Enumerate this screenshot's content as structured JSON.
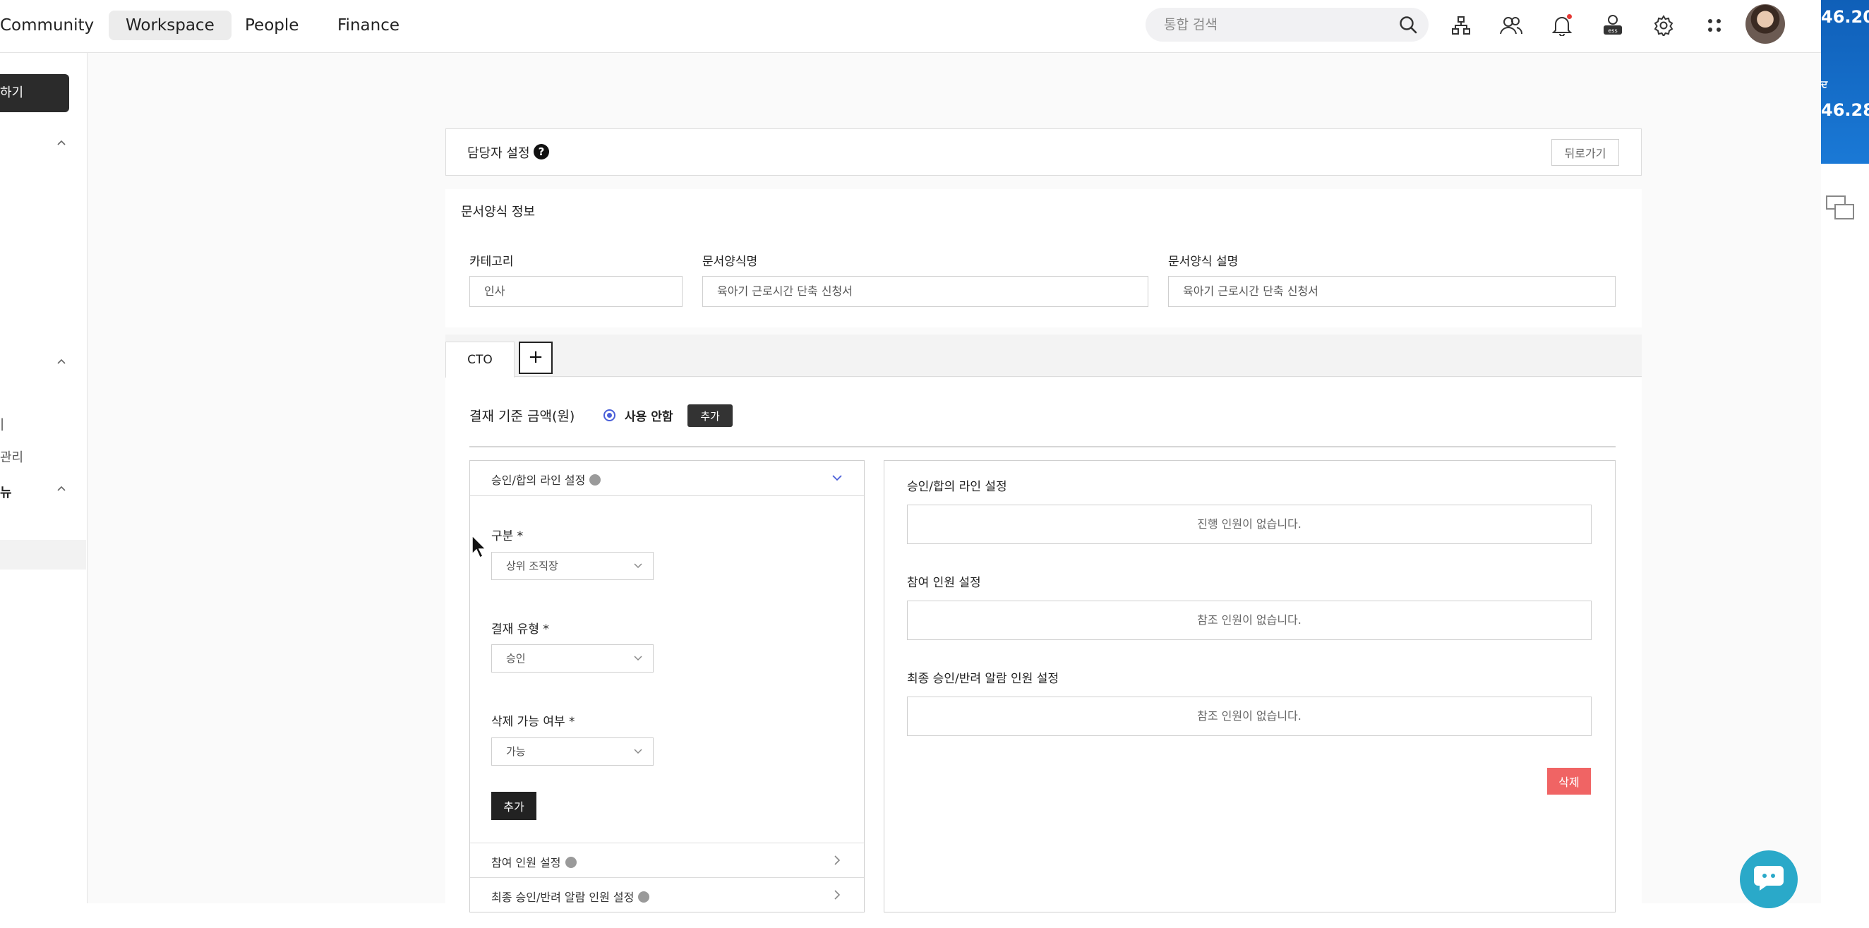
{
  "nav": {
    "items": [
      "Community",
      "Workspace",
      "People",
      "Finance"
    ],
    "active": "Workspace",
    "search_placeholder": "통합 검색"
  },
  "icons": {
    "org": "org-chart-icon",
    "people": "people-icon",
    "bell": "bell-icon",
    "ess": "ess-icon",
    "settings": "gear-icon",
    "apps": "apps-grid-icon"
  },
  "right_strip": {
    "clock1": "46.20",
    "clock2": "46.28"
  },
  "sidebar": {
    "button": "하기",
    "items": [
      "|",
      "관리",
      "뉴"
    ]
  },
  "header": {
    "title": "담당자 설정",
    "help": "?",
    "back": "뒤로가기"
  },
  "form_info": {
    "title": "문서양식 정보",
    "fields": [
      {
        "label": "카테고리",
        "value": "인사"
      },
      {
        "label": "문서양식명",
        "value": "육아기 근로시간 단축 신청서"
      },
      {
        "label": "문서양식 설명",
        "value": "육아기 근로시간 단축 신청서"
      }
    ]
  },
  "tabs": {
    "items": [
      "CTO"
    ],
    "add": "+"
  },
  "amount": {
    "label": "결재 기준 금액(원)",
    "radio_label": "사용 안함",
    "add": "추가"
  },
  "left_panel": {
    "approval_title": "승인/합의 라인 설정",
    "type_label": "구분 *",
    "type_value": "상위 조직장",
    "pay_type_label": "결재 유형 *",
    "pay_type_value": "승인",
    "deletable_label": "삭제 가능 여부 *",
    "deletable_value": "가능",
    "add": "추가",
    "participants_title": "참여 인원 설정",
    "final_title": "최종 승인/반려 알람 인원 설정"
  },
  "right_panel": {
    "approval_title": "승인/합의 라인 설정",
    "approval_empty": "진행 인원이 없습니다.",
    "participants_title": "참여 인원 설정",
    "participants_empty": "참조 인원이 없습니다.",
    "final_title": "최종 승인/반려 알람 인원 설정",
    "final_empty": "참조 인원이 없습니다.",
    "delete": "삭제"
  },
  "colors": {
    "accent_radio": "#4a5fd8",
    "delete": "#f06464",
    "dark_button": "#333333",
    "chat_fab": "#2aa9c9",
    "desktop_blue": "#0f5fb8"
  }
}
